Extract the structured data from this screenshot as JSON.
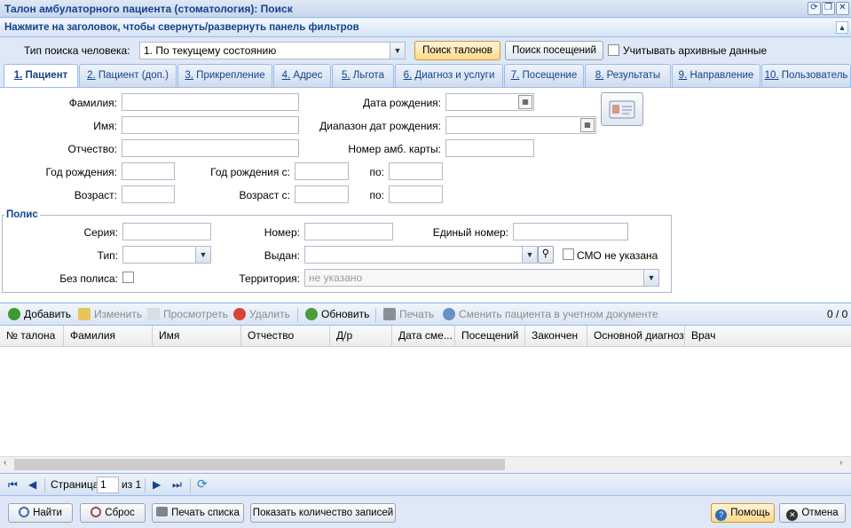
{
  "window": {
    "title": "Талон амбулаторного пациента (стоматология): Поиск"
  },
  "filter_header": "Нажмите на заголовок, чтобы свернуть/развернуть панель фильтров",
  "search_type": {
    "label": "Тип поиска человека:",
    "value": "1. По текущему состоянию"
  },
  "buttons": {
    "search_talons": "Поиск талонов",
    "search_visits": "Поиск посещений",
    "archive_label": "Учитывать архивные данные"
  },
  "tabs": [
    {
      "num": "1.",
      "label": " Пациент"
    },
    {
      "num": "2.",
      "label": " Пациент (доп.)"
    },
    {
      "num": "3.",
      "label": " Прикрепление"
    },
    {
      "num": "4.",
      "label": " Адрес"
    },
    {
      "num": "5.",
      "label": " Льгота"
    },
    {
      "num": "6.",
      "label": " Диагноз и услуги"
    },
    {
      "num": "7.",
      "label": " Посещение"
    },
    {
      "num": "8.",
      "label": " Результаты"
    },
    {
      "num": "9.",
      "label": " Направление"
    },
    {
      "num": "10.",
      "label": " Пользователь"
    }
  ],
  "patient": {
    "surname": "Фамилия:",
    "name": "Имя:",
    "patronymic": "Отчество:",
    "birth_year": "Год рождения:",
    "age": "Возраст:",
    "birth_date": "Дата рождения:",
    "birth_range": "Диапазон дат рождения:",
    "card_number": "Номер амб. карты:",
    "birth_year_from": "Год рождения с:",
    "to1": "по:",
    "age_from": "Возраст с:",
    "to2": "по:"
  },
  "policy": {
    "legend": "Полис",
    "series": "Серия:",
    "number": "Номер:",
    "unified": "Единый номер:",
    "type": "Тип:",
    "issued": "Выдан:",
    "smo_none": "СМО не указана",
    "no_policy": "Без полиса:",
    "territory": "Территория:",
    "territory_value": "не указано"
  },
  "toolbar": {
    "add": "Добавить",
    "edit": "Изменить",
    "view": "Просмотреть",
    "delete": "Удалить",
    "refresh": "Обновить",
    "print": "Печать",
    "change_patient": "Сменить пациента в учетном документе",
    "count": "0 / 0"
  },
  "grid_columns": [
    "№ талона",
    "Фамилия",
    "Имя",
    "Отчество",
    "Д/р",
    "Дата сме...",
    "Посещений",
    "Закончен",
    "Основной диагноз",
    "Врач"
  ],
  "pager": {
    "page_label": "Страница",
    "page_value": "1",
    "of_label": "из 1"
  },
  "bottom": {
    "find": "Найти",
    "reset": "Сброс",
    "print_list": "Печать списка",
    "show_count": "Показать количество записей",
    "help": "Помощь",
    "cancel": "Отмена"
  }
}
